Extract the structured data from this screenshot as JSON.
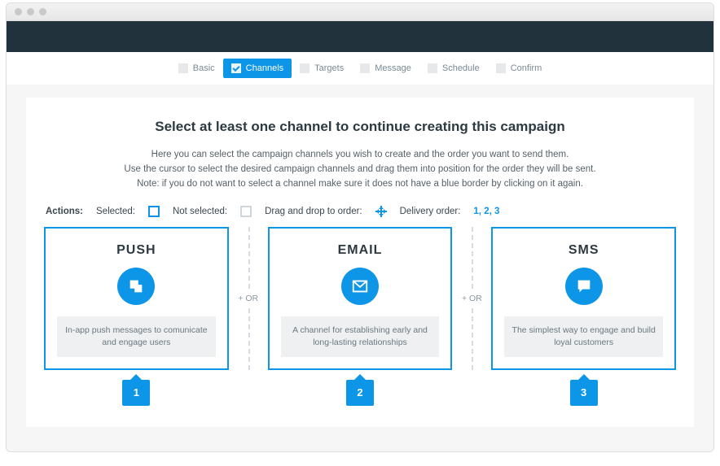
{
  "stepper": {
    "items": [
      {
        "label": "Basic"
      },
      {
        "label": "Channels"
      },
      {
        "label": "Targets"
      },
      {
        "label": "Message"
      },
      {
        "label": "Schedule"
      },
      {
        "label": "Confirm"
      }
    ]
  },
  "title": "Select at least one channel to continue creating this campaign",
  "lead1": "Here you can select the campaign channels you wish to create and the order you want to send them.",
  "lead2": "Use the cursor to select the desired campaign channels and drag them into position for the order they will be sent.",
  "lead3": "Note: if you do not want to select a channel make sure it does not have a blue border by clicking on it again.",
  "legend": {
    "actions": "Actions:",
    "selected": "Selected:",
    "not_selected": "Not selected:",
    "drag": "Drag and drop to order:",
    "delivery_label": "Delivery order:",
    "delivery_value": "1, 2, 3"
  },
  "divider": {
    "or": "+ OR"
  },
  "cards": [
    {
      "title": "PUSH",
      "desc": "In-app push messages to comunicate and engage users",
      "order": "1"
    },
    {
      "title": "EMAIL",
      "desc": "A channel for establishing early and long-lasting relationships",
      "order": "2"
    },
    {
      "title": "SMS",
      "desc": "The simplest way to engage and build loyal customers",
      "order": "3"
    }
  ],
  "colors": {
    "accent": "#0d95e8"
  }
}
